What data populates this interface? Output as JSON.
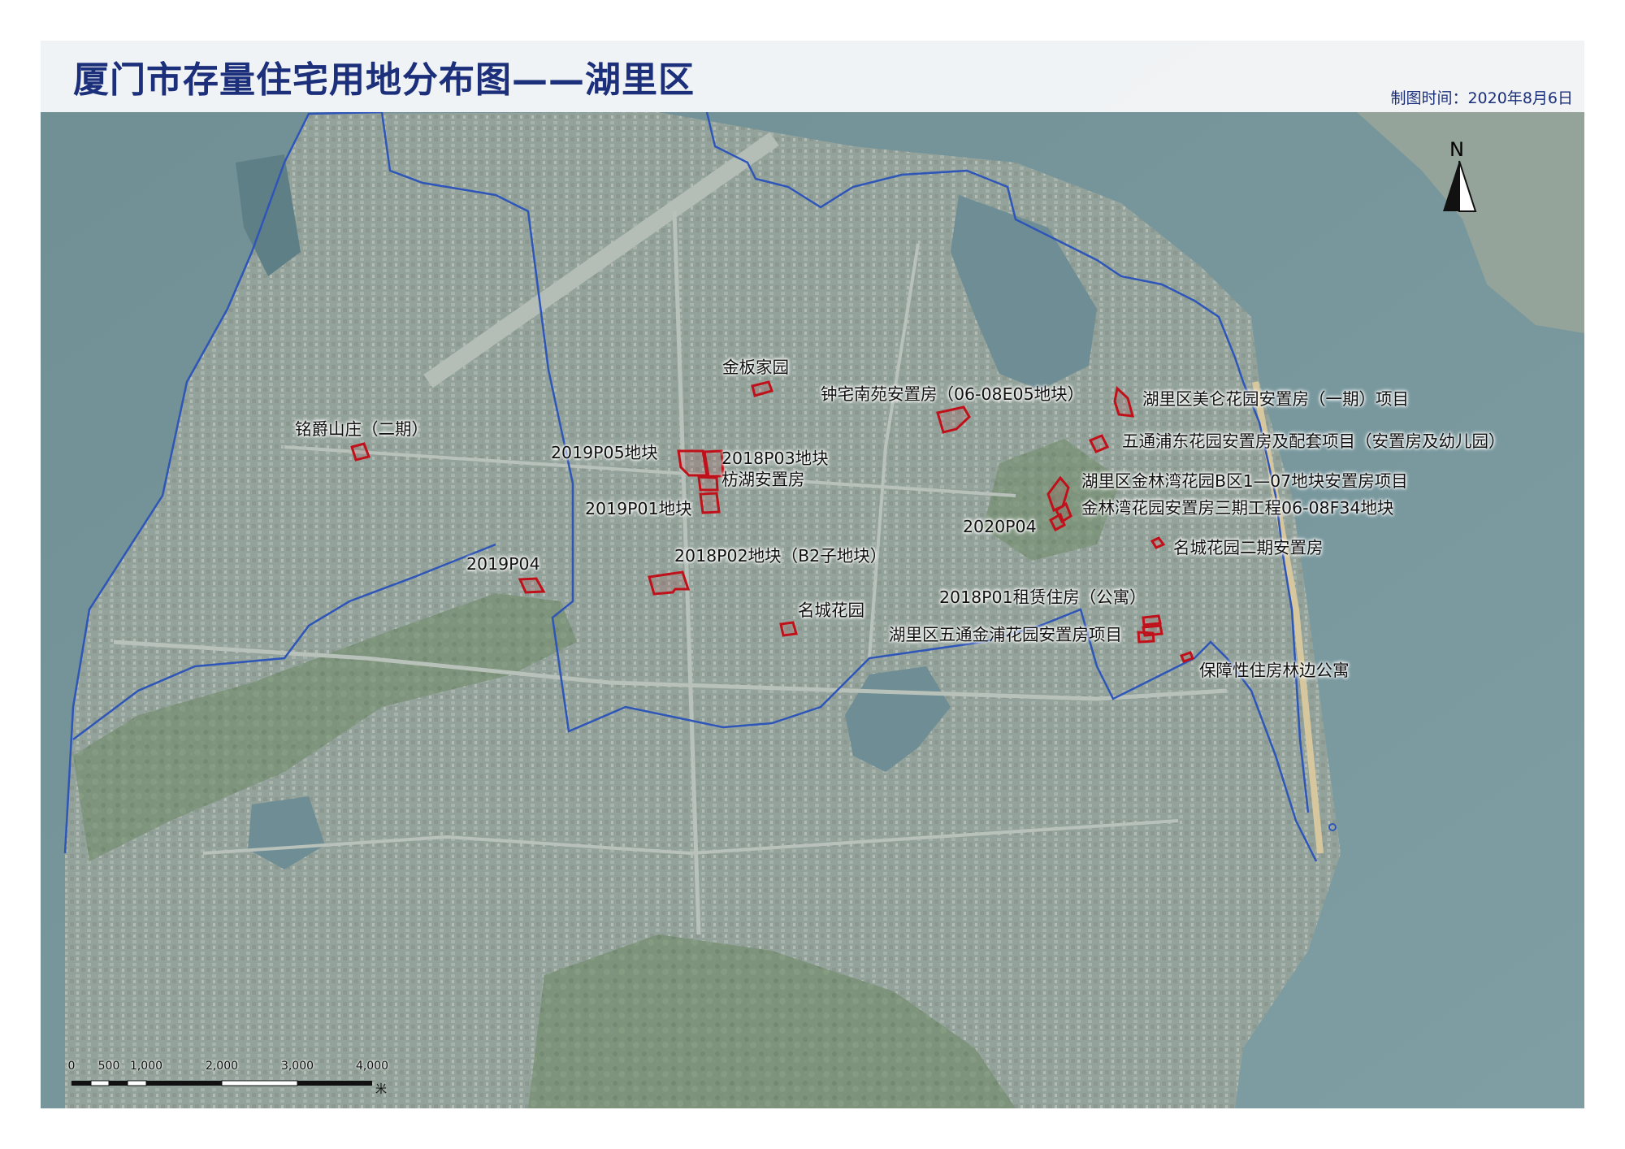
{
  "title": "厦门市存量住宅用地分布图——湖里区",
  "date_label": "制图时间：2020年8月6日",
  "north_label": "N",
  "parcel_color": "#c0101a",
  "boundary_color": "#2e55b8",
  "parcels": [
    {
      "name": "金板家园"
    },
    {
      "name": "钟宅南苑安置房（06-08E05地块）"
    },
    {
      "name": "湖里区美仑花园安置房（一期）项目"
    },
    {
      "name": "铭爵山庄（二期）"
    },
    {
      "name": "五通浦东花园安置房及配套项目（安置房及幼儿园）"
    },
    {
      "name": "2019P05地块"
    },
    {
      "name": "2018P03地块"
    },
    {
      "name": "枋湖安置房"
    },
    {
      "name": "湖里区金林湾花园B区1—07地块安置房项目"
    },
    {
      "name": "2019P01地块"
    },
    {
      "name": "金林湾花园安置房三期工程06-08F34地块"
    },
    {
      "name": "2020P04"
    },
    {
      "name": "名城花园二期安置房"
    },
    {
      "name": "2018P02地块（B2子地块）"
    },
    {
      "name": "2019P04"
    },
    {
      "name": "2018P01租赁住房（公寓）"
    },
    {
      "name": "名城花园"
    },
    {
      "name": "湖里区五通金浦花园安置房项目"
    },
    {
      "name": "保障性住房林边公寓"
    }
  ],
  "scale_bar": {
    "ticks": [
      "0",
      "500",
      "1,000",
      "2,000",
      "3,000",
      "4,000"
    ],
    "unit": "米"
  }
}
